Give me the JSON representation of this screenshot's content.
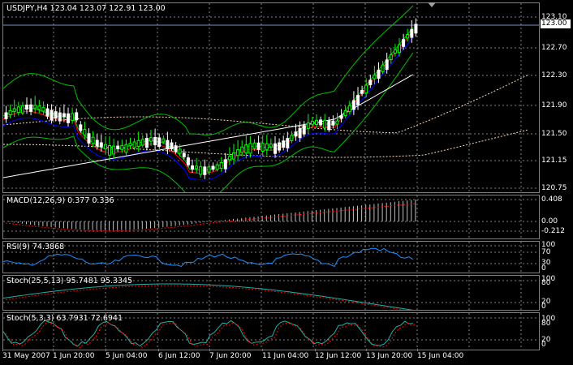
{
  "main": {
    "title": "USDJPY,H4  123.04 123.07 122.91 123.00",
    "current_price": "123.00",
    "ticks": [
      "123.10",
      "122.70",
      "122.30",
      "121.90",
      "121.50",
      "121.15",
      "120.75"
    ]
  },
  "macd": {
    "title": "MACD(12,26,9) 0.377 0.336",
    "ticks": [
      "0.408",
      "0.00",
      "-0.212"
    ]
  },
  "rsi": {
    "title": "RSI(9) 74.3868",
    "ticks": [
      "100",
      "70",
      "30",
      "0"
    ]
  },
  "stoch1": {
    "title": "Stoch(25,5,13) 95.7481 95.3345",
    "ticks": [
      "100",
      "80",
      "20",
      "0"
    ]
  },
  "stoch2": {
    "title": "Stoch(5,3,3) 63.7931 72.6941",
    "ticks": [
      "100",
      "80",
      "20",
      "0"
    ]
  },
  "xaxis": {
    "labels": [
      "31 May 2007",
      "1 Jun 20:00",
      "5 Jun 04:00",
      "6 Jun 12:00",
      "7 Jun 20:00",
      "11 Jun 04:00",
      "12 Jun 12:00",
      "13 Jun 20:00",
      "15 Jun 04:00"
    ]
  },
  "colors": {
    "background": "#000000",
    "grid": "#808080",
    "bull_candle": "#00ff00",
    "bear_candle": "#ffffff",
    "bollinger": "#00c000",
    "ma_fast": "#ff0000",
    "ma_mid": "#0000ff",
    "ma_slow": "#ffffff",
    "ichimoku_cloud": "#ffdab9",
    "macd_hist": "#c0c0c0",
    "macd_signal": "#ff0000",
    "rsi_line": "#1e90ff",
    "stoch_main": "#20b2aa",
    "stoch_signal": "#ff0000"
  }
}
